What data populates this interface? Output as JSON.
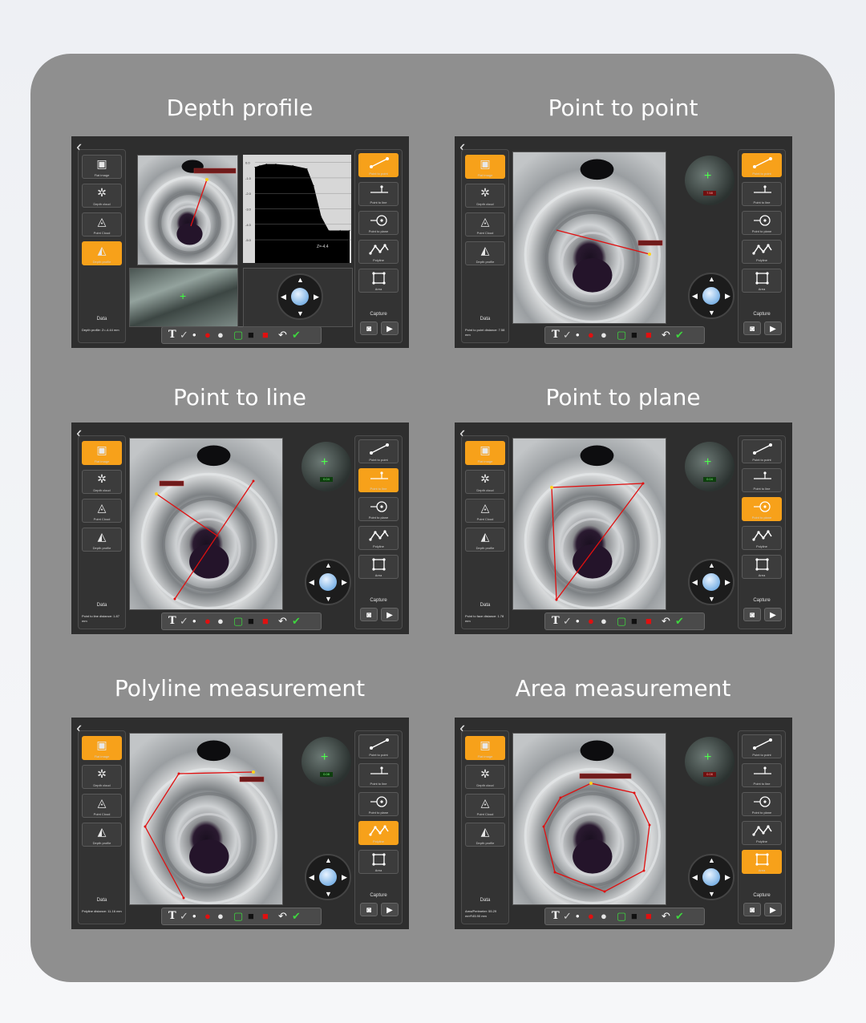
{
  "titles": {
    "p1": "Depth profile",
    "p2": "Point to point",
    "p3": "Point to line",
    "p4": "Point to plane",
    "p5": "Polyline measurement",
    "p6": "Area measurement"
  },
  "modes": [
    "Flat image",
    "Depth cloud",
    "Point Cloud",
    "Depth profile"
  ],
  "tools": [
    "Point to point",
    "Point to line",
    "Point to plane",
    "Polyline",
    "Area"
  ],
  "data_header": "Data",
  "capture_header": "Capture",
  "readouts": {
    "p1": "Depth profile: Z=-4.44 mm",
    "p2": "Point to point distance: 7.58 mm",
    "p3": "Point to line distance: 1.87 mm",
    "p4": "Point to face distance: 1.78 mm",
    "p5": "Polyline distance: 11.16 mm",
    "p6": "Area/Perimeter: 55.29 mm²/45.90 mm"
  },
  "thumb_values": {
    "p2": "7.58",
    "p3": "0.04",
    "p4": "0.04",
    "p5": "0.08",
    "p6": "0.08"
  },
  "chart_data": {
    "type": "area",
    "title": "",
    "y_ticks": [
      "0.0",
      "-1.0",
      "-2.0",
      "-3.0",
      "-4.0",
      "-5.0"
    ],
    "annotation": "Z=-4.4",
    "x": [
      0,
      5,
      12,
      22,
      40,
      55,
      62,
      70,
      78,
      90,
      100
    ],
    "y": [
      -0.3,
      -0.2,
      -0.1,
      -0.1,
      -0.2,
      -0.4,
      -1.5,
      -3.5,
      -4.4,
      -4.4,
      -4.4
    ],
    "ylim": [
      -6.5,
      0.5
    ],
    "color": "#000000"
  },
  "colors": {
    "active": "#f7a11a",
    "card": "#8f8f8f",
    "app_bg": "#2e2e2e",
    "measure_line": "#e01010"
  },
  "icons": [
    "back-icon",
    "text-icon",
    "pen-icon",
    "dot-icon",
    "red-dot-icon",
    "white-circle-icon",
    "green-square-icon",
    "black-square-icon",
    "red-square-icon",
    "undo-icon",
    "check-icon",
    "camera-icon",
    "video-icon"
  ]
}
